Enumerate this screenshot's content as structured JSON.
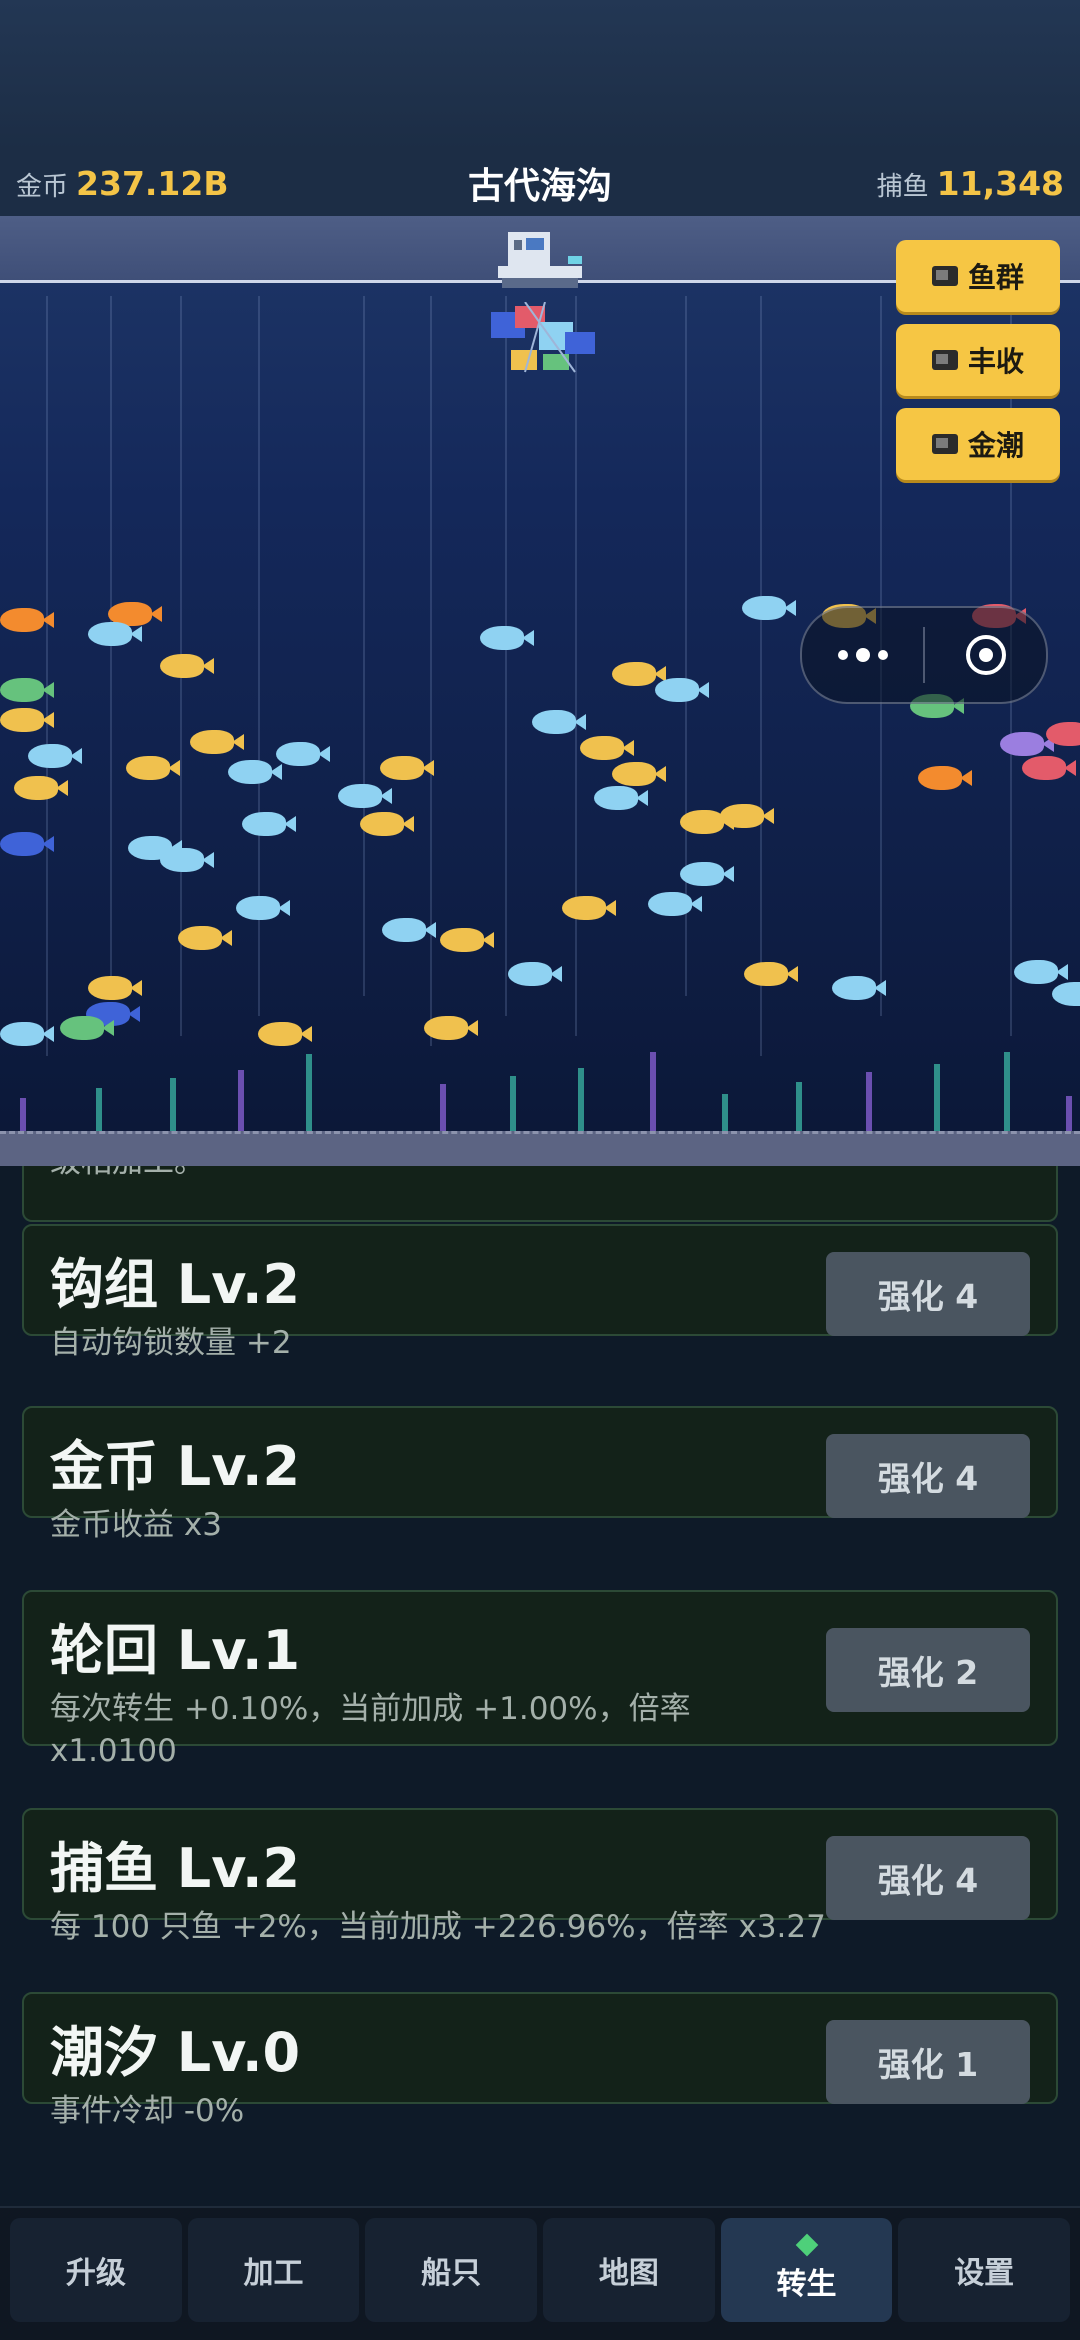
{
  "hud": {
    "gold_label": "金币",
    "gold_value": "237.12B",
    "area_title": "古代海沟",
    "fish_label": "捕鱼",
    "fish_value": "11,348"
  },
  "buffs": [
    {
      "label": "鱼群",
      "icon": "tv-icon"
    },
    {
      "label": "丰收",
      "icon": "tv-icon"
    },
    {
      "label": "金潮",
      "icon": "tv-icon"
    }
  ],
  "partial_card_text": "级相加工。",
  "upgrades": [
    {
      "name": "钩组 Lv.2",
      "desc": "自动钩锁数量 +2",
      "button": "强化 4"
    },
    {
      "name": "金币 Lv.2",
      "desc": "金币收益 x3",
      "button": "强化 4"
    },
    {
      "name": "轮回 Lv.1",
      "desc": "每次转生 +0.10%，当前加成 +1.00%，倍率 x1.0100",
      "button": "强化 2"
    },
    {
      "name": "捕鱼 Lv.2",
      "desc": "每 100 只鱼 +2%，当前加成 +226.96%，倍率 x3.27",
      "button": "强化 4"
    },
    {
      "name": "潮汐 Lv.0",
      "desc": "事件冷却 -0%",
      "button": "强化 1"
    }
  ],
  "nav": {
    "tabs": [
      "升级",
      "加工",
      "船只",
      "地图",
      "转生",
      "设置"
    ],
    "active": "转生"
  },
  "colors": {
    "accent_gold": "#f4c447",
    "buff_button": "#f6c644",
    "card_bg": "#132219",
    "upgrade_button": "#4a5560",
    "active_tab_gem": "#4ed07a"
  }
}
